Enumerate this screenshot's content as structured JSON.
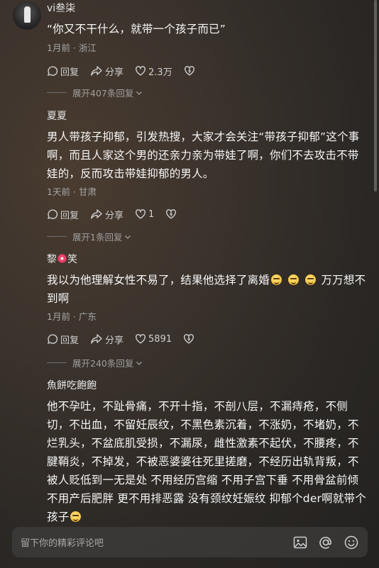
{
  "comments": [
    {
      "user": "vi叁柒",
      "text": "“你又不干什么，就带一个孩子而已”",
      "meta": "1月前 · 浙江",
      "reply": "回复",
      "share": "分享",
      "likes": "2.3万",
      "expand": "展开407条回复"
    },
    {
      "user": "夏夏",
      "text": "男人带孩子抑郁，引发热搜，大家才会关注“带孩子抑郁”这个事啊，而且人家这个男的还亲力亲为带娃了啊，你们不去攻击不带娃的，反而攻击带娃抑郁的男人。",
      "meta": "1天前 · 甘肃",
      "reply": "回复",
      "share": "分享",
      "likes": "1",
      "expand": "展开1条回复"
    },
    {
      "user_a": "黎",
      "user_b": "笑",
      "text_a": "我以为他理解女性不易了，结果他选择了离婚",
      "text_b": "万万想不到啊",
      "meta": "1月前 · 广东",
      "reply": "回复",
      "share": "分享",
      "likes": "5891",
      "expand": "展开240条回复"
    },
    {
      "user": "魚餅吃飽飽",
      "text": "他不孕吐，不趾骨痛，不开十指，不剖八层，不漏痔疮，不侧切，不出血，不留妊辰纹，不黑色素沉着，不涨奶，不堵奶，不烂乳头，不盆底肌受损，不漏尿，雌性激素不起伏，不腰疼，不腱鞘炎，不掉发，不被恶婆婆往死里搓磨，不经历出轨背叛，不被人贬低到一无是处 不用经历宫缩  不用子宫下垂  不用骨盆前倾  不用产后肥胖  更不用排恶露  没有颈纹妊娠纹  抑郁个der啊就带个孩子"
    }
  ],
  "input": {
    "placeholder": "留下你的精彩评论吧"
  },
  "icons": {
    "reply": "reply-icon",
    "share": "share-icon",
    "like": "heart-icon",
    "dislike": "dislike-icon",
    "image": "image-icon",
    "mention": "at-icon",
    "emoji": "emoji-icon"
  }
}
